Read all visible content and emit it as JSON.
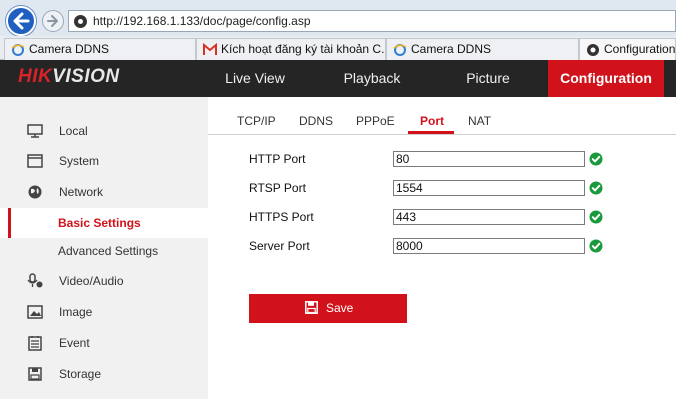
{
  "browser": {
    "url": "http://192.168.1.133/doc/page/config.asp",
    "tabs": [
      {
        "label": "Camera DDNS"
      },
      {
        "label": "Kích hoạt đăng ký tài khoản C..."
      },
      {
        "label": "Camera DDNS"
      },
      {
        "label": "Configuration"
      }
    ]
  },
  "app": {
    "logo_part1": "HIK",
    "logo_part2": "VISION",
    "nav": [
      {
        "label": "Live View"
      },
      {
        "label": "Playback"
      },
      {
        "label": "Picture"
      },
      {
        "label": "Configuration"
      }
    ],
    "accent_color": "#d2121a"
  },
  "sidebar": {
    "items": [
      {
        "label": "Local",
        "icon": "monitor-icon"
      },
      {
        "label": "System",
        "icon": "system-icon"
      },
      {
        "label": "Network",
        "icon": "globe-icon"
      },
      {
        "label": "Basic Settings",
        "icon": ""
      },
      {
        "label": "Advanced Settings",
        "icon": ""
      },
      {
        "label": "Video/Audio",
        "icon": "video-audio-icon"
      },
      {
        "label": "Image",
        "icon": "image-icon"
      },
      {
        "label": "Event",
        "icon": "event-icon"
      },
      {
        "label": "Storage",
        "icon": "storage-icon"
      }
    ],
    "selected": "Basic Settings"
  },
  "content": {
    "tabs": [
      {
        "label": "TCP/IP"
      },
      {
        "label": "DDNS"
      },
      {
        "label": "PPPoE"
      },
      {
        "label": "Port"
      },
      {
        "label": "NAT"
      }
    ],
    "active_tab": "Port",
    "fields": [
      {
        "label": "HTTP Port",
        "value": "80"
      },
      {
        "label": "RTSP Port",
        "value": "1554"
      },
      {
        "label": "HTTPS Port",
        "value": "443"
      },
      {
        "label": "Server Port",
        "value": "8000"
      }
    ],
    "save_label": "Save"
  }
}
